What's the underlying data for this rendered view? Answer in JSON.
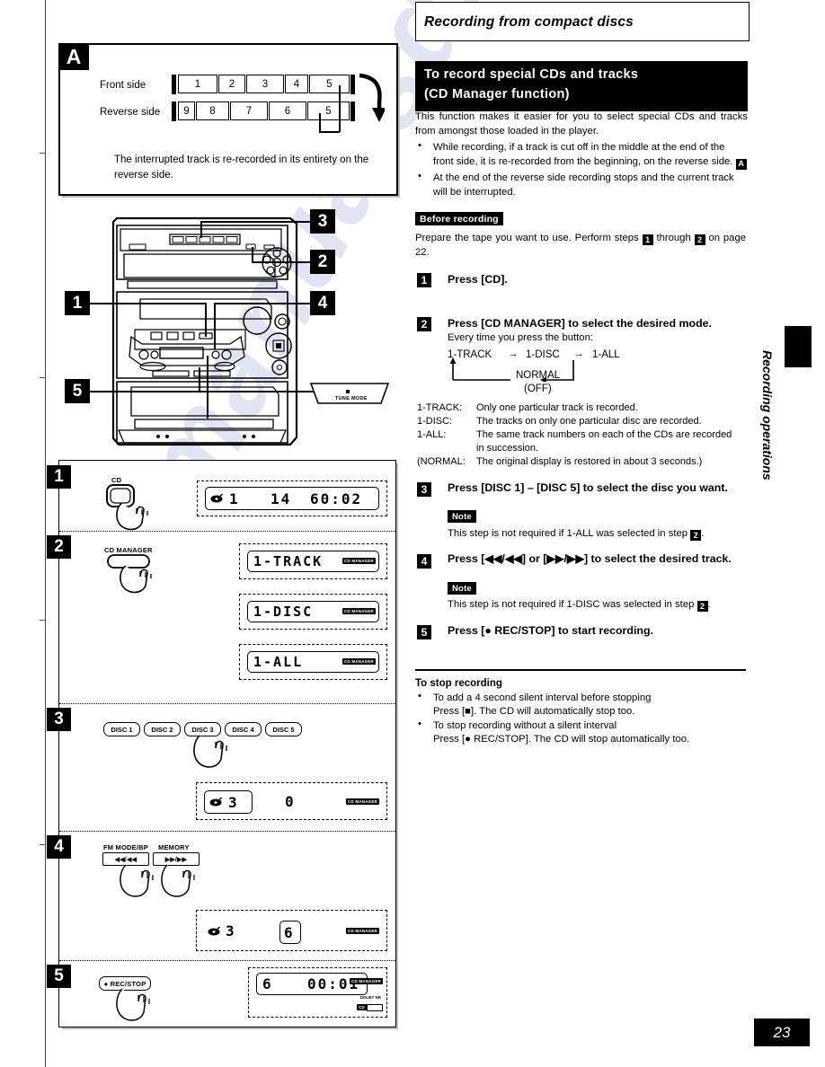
{
  "page": {
    "number": "23",
    "side_tab": "Recording operations"
  },
  "chapter": {
    "title": "Recording from compact discs"
  },
  "section": {
    "heading_line1": "To record special CDs and tracks",
    "heading_line2": "(CD Manager function)",
    "intro": "This function makes it easier for you to select special CDs and tracks from amongst those loaded in the player.",
    "bullets": [
      "While recording, if a track is cut off in the middle at the end of the front side, it is re-recorded from the beginning, on the reverse side.",
      "At the end of the reverse side recording stops and the current track will be interrupted."
    ],
    "bullet1_tag": "A"
  },
  "before_recording": {
    "label": "Before recording",
    "text_a": "Prepare the tape you want to use. Perform steps",
    "tag1": "1",
    "text_b": "through",
    "tag2": "2",
    "text_c": "on page 22."
  },
  "steps_right": [
    {
      "num": "1",
      "title": "Press [CD]."
    },
    {
      "num": "2",
      "title": "Press [CD MANAGER] to select the desired mode.",
      "sub": "Every time you press the button:"
    },
    {
      "num": "3",
      "title": "Press [DISC 1] – [DISC 5] to select the disc you want.",
      "note_label": "Note",
      "note_a": "This step is not required if 1-ALL was selected in step",
      "note_tag": "2",
      "note_b": "."
    },
    {
      "num": "4",
      "title": "Press [◀◀/◀◀] or [▶▶/▶▶] to select the desired track.",
      "note_label": "Note",
      "note_a": "This step is not required if 1-DISC was selected in step",
      "note_tag": "2",
      "note_b": "."
    },
    {
      "num": "5",
      "title": "Press [● REC/STOP] to start recording."
    }
  ],
  "flow": {
    "item1": "1-TRACK",
    "arrow1": "→",
    "item2": "1-DISC",
    "arrow2": "→",
    "item3": "1-ALL",
    "item4": "NORMAL",
    "item4_sub": "(OFF)"
  },
  "definitions": [
    {
      "term": "1-TRACK:",
      "desc": "Only one particular track is recorded."
    },
    {
      "term": "1-DISC:",
      "desc": "The tracks on only one particular disc are recorded."
    },
    {
      "term": "1-ALL:",
      "desc": "The same track numbers on each of the CDs are recorded in succession."
    },
    {
      "term": "(NORMAL:",
      "desc": "The original display is restored in about 3 seconds.)"
    }
  ],
  "to_stop": {
    "heading": "To stop recording",
    "items": [
      {
        "line1": "To add a 4 second silent interval before stopping",
        "line2": "Press [■]. The CD will automatically stop too."
      },
      {
        "line1": "To stop recording without a silent interval",
        "line2": "Press [● REC/STOP]. The CD will stop automatically too."
      }
    ]
  },
  "panel_a": {
    "tag": "A",
    "front_label": "Front side",
    "reverse_label": "Reverse side",
    "front_tracks": [
      "1",
      "2",
      "3",
      "4",
      "5"
    ],
    "reverse_tracks": [
      "9",
      "8",
      "7",
      "6",
      "5"
    ],
    "caption": "The interrupted track is re-recorded in its entirety on the reverse side."
  },
  "stereo_callouts": [
    "3",
    "2",
    "1",
    "4",
    "5"
  ],
  "remote": {
    "tune_mode_label": "TUNE MODE"
  },
  "steps_left": [
    {
      "num": "1",
      "button_label": "CD",
      "displays": [
        {
          "disc_icon": true,
          "disc": "1",
          "track": "14",
          "time": "60:02",
          "badge": ""
        }
      ]
    },
    {
      "num": "2",
      "button_label": "CD MANAGER",
      "displays": [
        {
          "text": "1-TRACK",
          "badge": "CD MANAGER"
        },
        {
          "text": "1-DISC",
          "badge": "CD MANAGER"
        },
        {
          "text": "1-ALL",
          "badge": "CD MANAGER"
        }
      ]
    },
    {
      "num": "3",
      "disc_buttons": [
        "DISC 1",
        "DISC 2",
        "DISC 3",
        "DISC 4",
        "DISC 5"
      ],
      "displays": [
        {
          "disc_icon": true,
          "disc": "3",
          "track": "0",
          "badge": "CD MANAGER"
        }
      ]
    },
    {
      "num": "4",
      "button_labels": [
        "FM MODE/BP",
        "MEMORY"
      ],
      "button_glyphs": [
        "◀◀/◀◀",
        "▶▶/▶▶"
      ],
      "displays": [
        {
          "disc_icon": true,
          "disc": "3",
          "track": "6",
          "badge": "CD MANAGER"
        }
      ]
    },
    {
      "num": "5",
      "button_label": "● REC/STOP",
      "displays": [
        {
          "disc": "6",
          "time": "00:01",
          "badge": "CD MANAGER",
          "sub_badge": "CD",
          "dolby": "DOLBY NR"
        }
      ]
    }
  ],
  "colors": {
    "ink": "#000000",
    "paper": "#ffffff",
    "watermark": "#c9cfe8"
  }
}
